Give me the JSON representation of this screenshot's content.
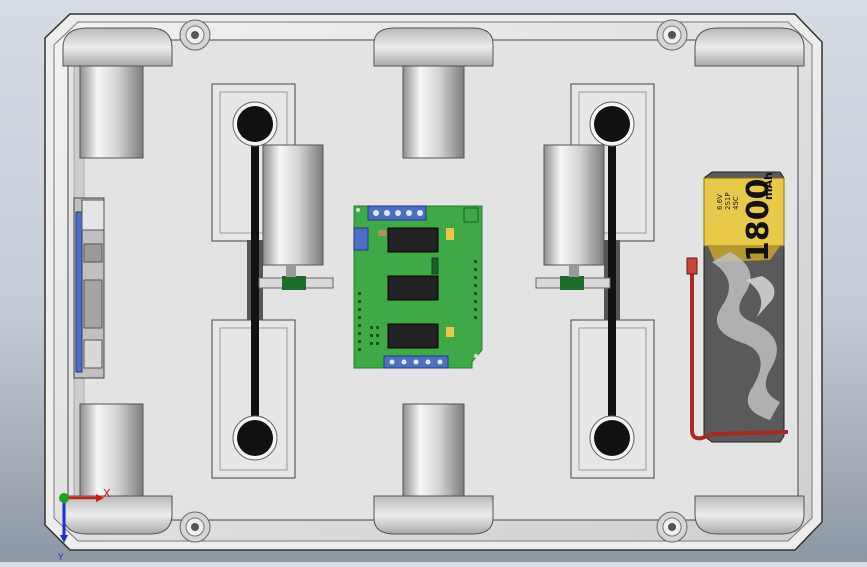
{
  "scene": {
    "type": "CAD top view of rover chassis",
    "view": "top"
  },
  "battery": {
    "capacity_label": "1800",
    "unit_label": "mAh",
    "specs": [
      "6.6V",
      "2S1P",
      "45C"
    ]
  },
  "triad": {
    "x_label": "X",
    "y_label": "Y"
  },
  "colors": {
    "background_top": "#d6dce4",
    "background_bottom": "#8d97a3",
    "chassis": "#e1e1e1",
    "pcb": "#3fa847",
    "battery_label": "#e8c94a",
    "wire": "#a52a23",
    "belt": "#111111",
    "axis_x": "#d11a1a",
    "axis_y": "#1ca21c",
    "axis_z": "#1a2fd1"
  },
  "icons": [
    "axis-triad-icon",
    "dragon-graphic-icon"
  ]
}
